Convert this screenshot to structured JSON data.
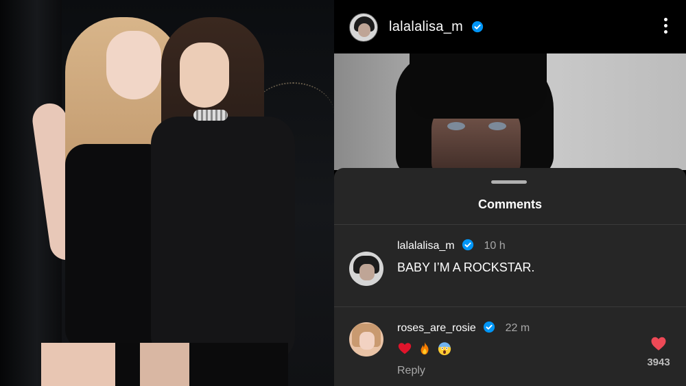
{
  "post": {
    "username": "lalalalisa_m",
    "icons": {
      "verified": "verified-badge-icon",
      "more": "more-options-icon"
    }
  },
  "comments_sheet": {
    "title": "Comments",
    "items": [
      {
        "username": "lalalalisa_m",
        "time": "10 h",
        "text": "BABY I’M A ROCKSTAR."
      },
      {
        "username": "roses_are_rosie",
        "time": "22 m",
        "emojis": [
          "red-heart-icon",
          "fire-icon",
          "screaming-face-icon"
        ],
        "reply_label": "Reply",
        "like_count": "3943"
      }
    ]
  },
  "colors": {
    "verified_blue": "#0095f6",
    "heart_red": "#ed4956",
    "sheet_bg": "#262626"
  }
}
